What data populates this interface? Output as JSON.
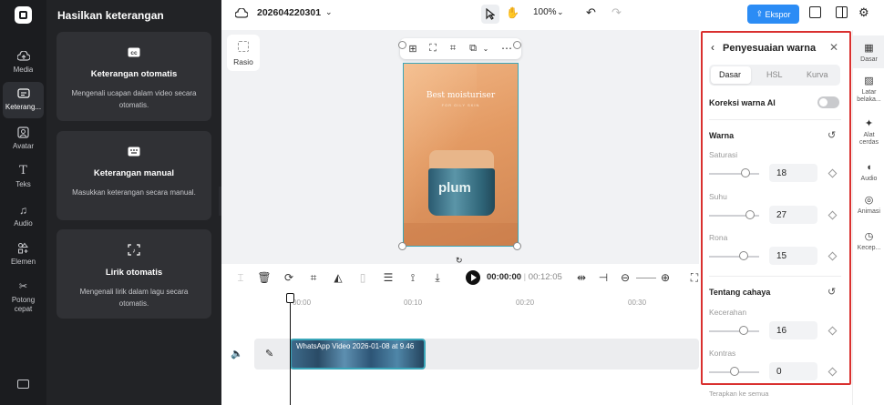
{
  "rail": {
    "items": [
      {
        "label": "Media",
        "icon": "cloud-upload-icon"
      },
      {
        "label": "Keterang...",
        "icon": "captions-icon"
      },
      {
        "label": "Avatar",
        "icon": "avatar-icon"
      },
      {
        "label": "Teks",
        "icon": "text-icon"
      },
      {
        "label": "Audio",
        "icon": "music-icon"
      },
      {
        "label": "Elemen",
        "icon": "elements-icon"
      },
      {
        "label": "Potong cepat",
        "icon": "scissors-icon"
      }
    ]
  },
  "left_panel": {
    "title": "Hasilkan keterangan",
    "cards": [
      {
        "title": "Keterangan otomatis",
        "desc": "Mengenali ucapan dalam video secara otomatis."
      },
      {
        "title": "Keterangan manual",
        "desc": "Masukkan keterangan secara manual."
      },
      {
        "title": "Lirik otomatis",
        "desc": "Mengenali lirik dalam lagu secara otomatis."
      }
    ]
  },
  "topbar": {
    "project": "202604220301",
    "zoom": "100%",
    "export": "Ekspor"
  },
  "canvas": {
    "ratio_label": "Rasio",
    "video_text": "Best moisturiser",
    "video_sub": "FOR OILY SKIN",
    "brand": "plum"
  },
  "timeline": {
    "current_time": "00:00:00",
    "total_time": "00:12:05",
    "ticks": [
      "00:00",
      "00:10",
      "00:20",
      "00:30"
    ],
    "clip_label": "WhatsApp Video 2026-01-08 at 9.46"
  },
  "color_panel": {
    "title": "Penyesuaian warna",
    "tabs": [
      "Dasar",
      "HSL",
      "Kurva"
    ],
    "active_tab": "Dasar",
    "ai_correction": "Koreksi warna AI",
    "ai_enabled": false,
    "section_color": "Warna",
    "saturation_label": "Saturasi",
    "saturation": "18",
    "temperature_label": "Suhu",
    "temperature": "27",
    "hue_label": "Rona",
    "hue": "15",
    "section_light": "Tentang cahaya",
    "brightness_label": "Kecerahan",
    "brightness": "16",
    "contrast_label": "Kontras",
    "contrast": "0",
    "apply_all": "Terapkan ke semua"
  },
  "far_rail": {
    "items": [
      "Dasar",
      "Latar belaka...",
      "Alat cerdas",
      "Audio",
      "Animasi",
      "Kecep..."
    ]
  },
  "colors": {
    "accent": "#2b8cf5",
    "highlight_border": "#d9302f",
    "clip_border": "#3aa6b9"
  }
}
